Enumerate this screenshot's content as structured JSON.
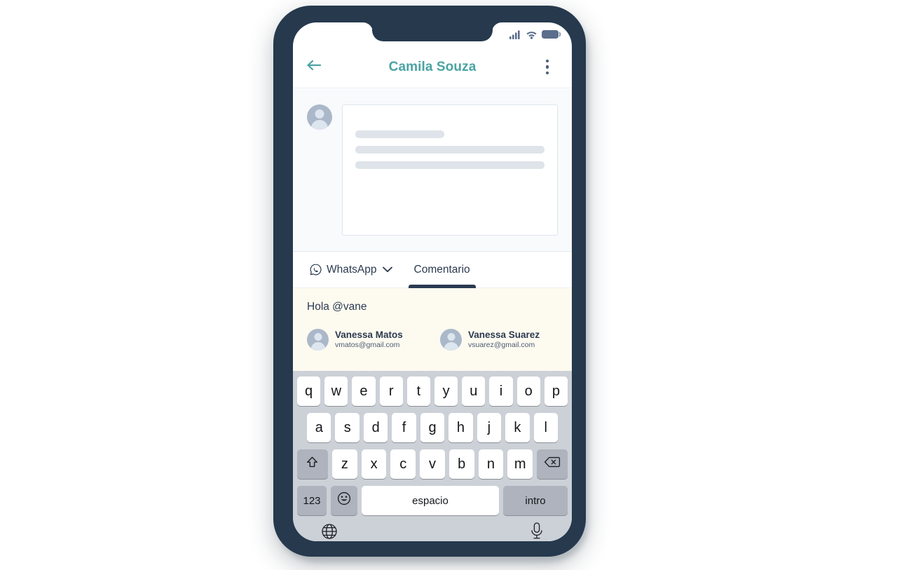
{
  "status_bar": {
    "icons": [
      "signal-bars-icon",
      "wifi-icon",
      "battery-icon"
    ],
    "color": "#5b6e8c"
  },
  "header": {
    "back_icon": "back-arrow-icon",
    "title": "Camila Souza",
    "title_color": "#4ba3a3",
    "menu_icon": "more-vertical-icon"
  },
  "message_area": {
    "avatar_icon": "user-avatar-icon",
    "skeleton_lines": [
      "short",
      "full",
      "full"
    ],
    "background": "#f8fafc"
  },
  "tabs": [
    {
      "label": "WhatsApp",
      "icon": "whatsapp-icon",
      "chevron": "chevron-down-icon",
      "active": false
    },
    {
      "label": "Comentario",
      "icon": "",
      "chevron": "",
      "active": true
    }
  ],
  "tab_active_color": "#2b3a52",
  "compose": {
    "text": "Hola @vane",
    "background": "#fdfaf0"
  },
  "mentions": [
    {
      "name": "Vanessa Matos",
      "email": "vmatos@gmail.com",
      "avatar_icon": "user-avatar-icon"
    },
    {
      "name": "Vanessa Suarez",
      "email": "vsuarez@gmail.com",
      "avatar_icon": "user-avatar-icon"
    }
  ],
  "keyboard": {
    "row1": [
      "q",
      "w",
      "e",
      "r",
      "t",
      "y",
      "u",
      "i",
      "o",
      "p"
    ],
    "row2": [
      "a",
      "s",
      "d",
      "f",
      "g",
      "h",
      "j",
      "k",
      "l"
    ],
    "row3": [
      "z",
      "x",
      "c",
      "v",
      "b",
      "n",
      "m"
    ],
    "shift_icon": "shift-up-arrow-icon",
    "backspace_icon": "backspace-delete-icon",
    "numbers_label": "123",
    "emoji_icon": "smiley-face-icon",
    "space_label": "espacio",
    "enter_label": "intro",
    "globe_icon": "globe-language-icon",
    "mic_icon": "microphone-icon",
    "background": "#ccd0d7"
  },
  "frame": {
    "body_color": "#26394d"
  }
}
